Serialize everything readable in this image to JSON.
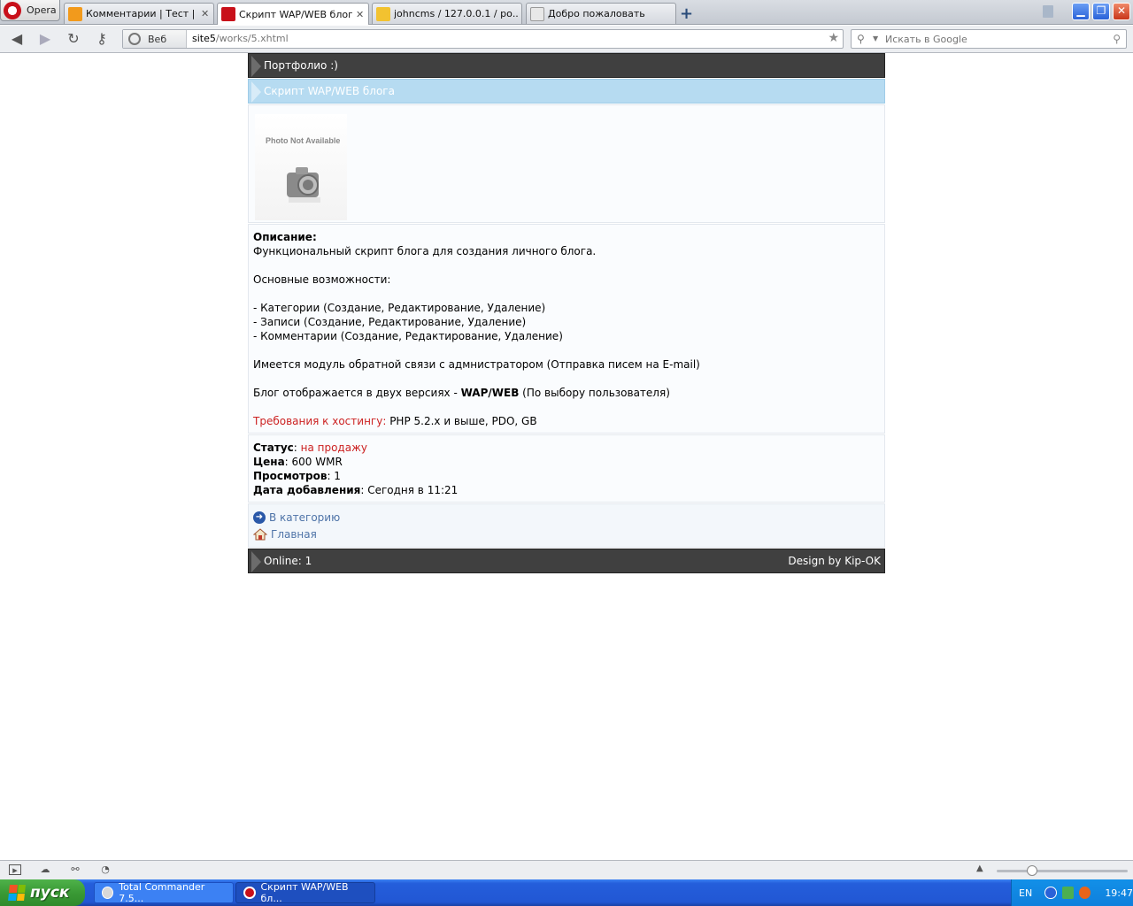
{
  "browser": {
    "menu_label": "Opera",
    "tabs": [
      {
        "title": "Комментарии | Тест | Н...",
        "active": false
      },
      {
        "title": "Скрипт WAP/WEB блога",
        "active": true
      },
      {
        "title": "johncms / 127.0.0.1 / ро...",
        "active": false
      },
      {
        "title": "Добро пожаловать",
        "active": false
      }
    ],
    "url_badge": "Веб",
    "url_host": "site5",
    "url_path": "/works/5.xhtml",
    "search_placeholder": "Искать в Google"
  },
  "page": {
    "header_title": "Портфолио :)",
    "subheader_title": "Скрипт WAP/WEB блога",
    "photo_text": "Photo Not Available",
    "description": {
      "label": "Описание:",
      "intro": "Функциональный скрипт блога для создания личного блога.",
      "features_title": "Основные возможности:",
      "features": [
        "- Категории (Создание, Редактирование, Удаление)",
        "- Записи (Создание, Редактирование, Удаление)",
        "- Комментарии (Создание, Редактирование, Удаление)"
      ],
      "feedback": "Имеется модуль обратной связи с адмнистратором (Отправка писем на E-mail)",
      "versions_prefix": "Блог отображается в двух версиях - ",
      "versions_bold": "WAP/WEB",
      "versions_suffix": " (По выбору пользователя)",
      "hosting_label": "Требования к хостингу:",
      "hosting_value": " PHP 5.2.x и выше, PDO, GB"
    },
    "info": {
      "status_label": "Статус",
      "status_value": "на продажу",
      "price_label": "Цена",
      "price_value": ": 600 WMR",
      "views_label": "Просмотров",
      "views_value": ": 1",
      "date_label": "Дата добавления",
      "date_value": ": Сегодня в 11:21"
    },
    "links": {
      "category": "В категорию",
      "home": "Главная"
    },
    "footer": {
      "online": "Online: 1",
      "design": "Design by Kip-OK"
    }
  },
  "taskbar": {
    "start_label": "пуск",
    "tasks": [
      {
        "label": "Total Commander 7.5...",
        "active": false
      },
      {
        "label": "Скрипт WAP/WEB бл...",
        "active": true
      }
    ],
    "lang": "EN",
    "clock": "19:47"
  },
  "colors": {
    "header_dark": "#404040",
    "header_light": "#b6dbf1",
    "link": "#4f74a8",
    "accent_red": "#cc2222"
  }
}
